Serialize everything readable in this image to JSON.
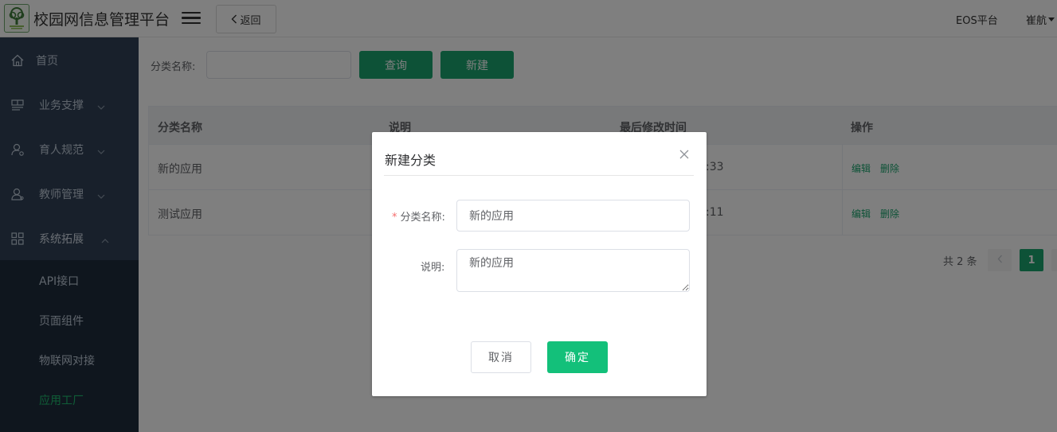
{
  "header": {
    "app_title": "校园网信息管理平台",
    "back_label": "返回",
    "eos_link": "EOS平台",
    "user_name": "崔航"
  },
  "sidebar": {
    "items": [
      {
        "label": "首页",
        "icon": "home-icon"
      },
      {
        "label": "业务支撑",
        "icon": "layout-icon"
      },
      {
        "label": "育人规范",
        "icon": "user-settings-icon"
      },
      {
        "label": "教师管理",
        "icon": "teacher-icon"
      },
      {
        "label": "系统拓展",
        "icon": "apps-icon"
      }
    ],
    "sub_items": [
      {
        "label": "API接口"
      },
      {
        "label": "页面组件"
      },
      {
        "label": "物联网对接"
      },
      {
        "label": "应用工厂"
      }
    ]
  },
  "search": {
    "label": "分类名称:",
    "value": "",
    "query_label": "查询",
    "new_label": "新建"
  },
  "table": {
    "columns": [
      "分类名称",
      "说明",
      "最后修改时间",
      "操作"
    ],
    "rows": [
      {
        "name": "新的应用",
        "desc": "",
        "time_visible": ":33",
        "edit": "编辑",
        "delete": "删除"
      },
      {
        "name": "测试应用",
        "desc": "",
        "time_visible": ":11",
        "edit": "编辑",
        "delete": "删除"
      }
    ]
  },
  "pagination": {
    "total": "共 2 条",
    "current_page": "1"
  },
  "dialog": {
    "title": "新建分类",
    "name_label": "分类名称:",
    "name_value": "新的应用",
    "desc_label": "说明:",
    "desc_value": "新的应用",
    "cancel_label": "取消",
    "confirm_label": "确定"
  },
  "colors": {
    "sidebar_bg": "#304156",
    "sidebar_sub_bg": "#1f2d3d",
    "primary_green": "#1ba56e",
    "confirm_green": "#13c07a",
    "active_menu": "#1fba6e",
    "required": "#f56c6c"
  }
}
